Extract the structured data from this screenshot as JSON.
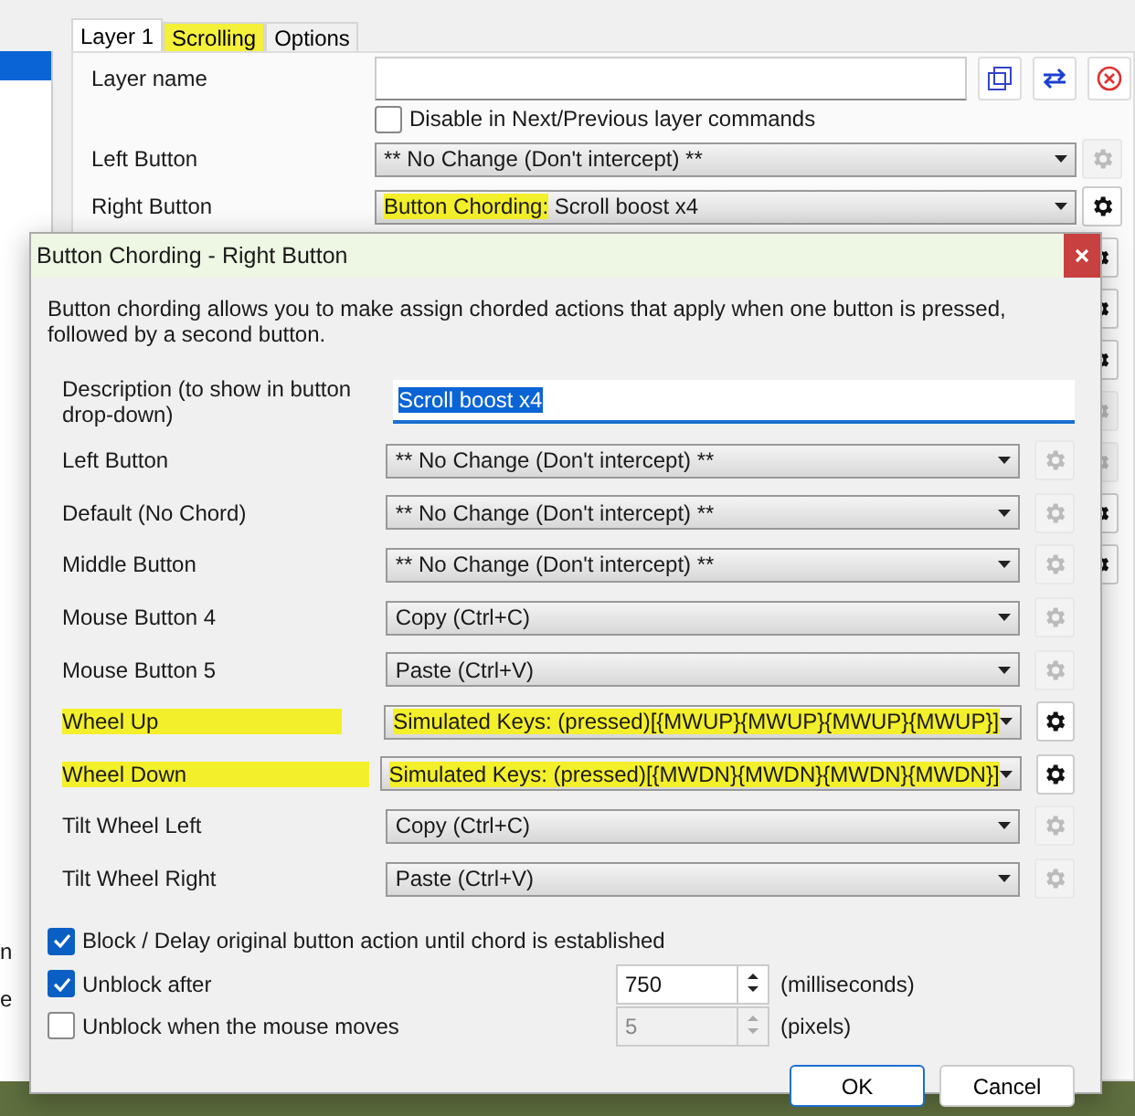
{
  "sidebar": {
    "items": [
      {
        "selected": true
      }
    ],
    "fragments": [
      "n",
      "e"
    ]
  },
  "tabs": [
    {
      "label": "Layer 1",
      "selected": true,
      "highlighted": false
    },
    {
      "label": "Scrolling",
      "selected": false,
      "highlighted": true
    },
    {
      "label": "Options",
      "selected": false,
      "highlighted": false
    }
  ],
  "layer": {
    "name_label": "Layer name",
    "disable_checkbox": {
      "label": "Disable in Next/Previous layer commands",
      "checked": false
    },
    "buttons": [
      {
        "label": "Left Button",
        "value": "** No Change (Don't intercept) **",
        "configurable": false
      },
      {
        "label": "Right Button",
        "value": "Scroll boost x4",
        "highlight": "Button Chording:",
        "configurable": true
      }
    ],
    "hidden_gears": [
      {
        "configurable": true
      },
      {
        "configurable": true
      },
      {
        "configurable": true
      },
      {
        "configurable": false
      },
      {
        "configurable": false
      },
      {
        "configurable": true
      },
      {
        "configurable": true
      }
    ]
  },
  "dialog": {
    "title": "Button Chording - Right Button",
    "intro": "Button chording allows you to make assign chorded actions that apply when one button is pressed, followed by a second button.",
    "description_label": "Description (to show in button drop-down)",
    "description_value": "Scroll boost x4",
    "rows": [
      {
        "label": "Left Button",
        "value": "** No Change (Don't intercept) **",
        "configurable": false,
        "highlighted": false
      },
      {
        "label": "Default (No Chord)",
        "value": "** No Change (Don't intercept) **",
        "configurable": false,
        "highlighted": false
      },
      {
        "label": "Middle Button",
        "value": "** No Change (Don't intercept) **",
        "configurable": false,
        "highlighted": false
      },
      {
        "label": "Mouse Button 4",
        "value": "Copy (Ctrl+C)",
        "configurable": false,
        "highlighted": false
      },
      {
        "label": "Mouse Button 5",
        "value": "Paste (Ctrl+V)",
        "configurable": false,
        "highlighted": false
      },
      {
        "label": "Wheel Up",
        "value": "Simulated Keys: (pressed)[{MWUP}{MWUP}{MWUP}{MWUP}]",
        "configurable": true,
        "highlighted": true
      },
      {
        "label": "Wheel Down",
        "value": "Simulated Keys: (pressed)[{MWDN}{MWDN}{MWDN}{MWDN}]",
        "configurable": true,
        "highlighted": true
      },
      {
        "label": "Tilt Wheel Left",
        "value": "Copy (Ctrl+C)",
        "configurable": false,
        "highlighted": false
      },
      {
        "label": "Tilt Wheel Right",
        "value": "Paste (Ctrl+V)",
        "configurable": false,
        "highlighted": false
      }
    ],
    "options": [
      {
        "label": "Block / Delay original button action until chord is established",
        "checked": true
      },
      {
        "label": "Unblock after",
        "checked": true,
        "spin_value": "750",
        "unit": "(milliseconds)"
      },
      {
        "label": "Unblock when the mouse moves",
        "checked": false,
        "spin_value": "5",
        "unit": "(pixels)"
      }
    ],
    "buttons": [
      {
        "label": "OK",
        "default": true
      },
      {
        "label": "Cancel",
        "default": false
      }
    ]
  }
}
